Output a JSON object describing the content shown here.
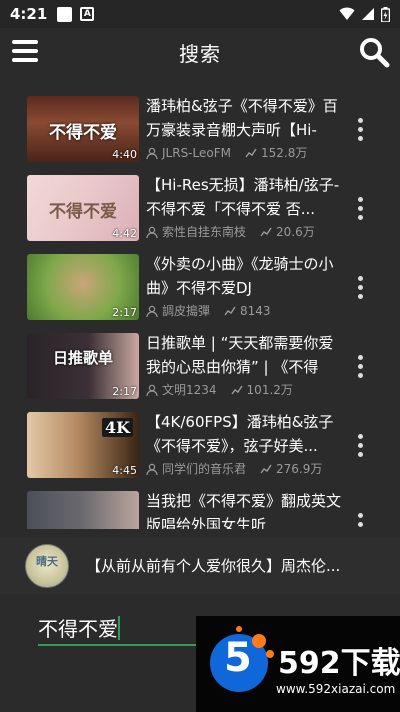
{
  "status_bar": {
    "time": "4:21",
    "notification_icon": "A"
  },
  "header": {
    "title": "搜索"
  },
  "results": [
    {
      "title": "潘玮柏&弦子《不得不爱》百万豪装录音棚大声听【Hi-",
      "thumb_text": "不得不爱",
      "duration": "4:40",
      "uploader": "JLRS-LeoFM",
      "views": "152.8万"
    },
    {
      "title": "【Hi-Res无损】潘玮柏/弦子-不得不爱「不得不爱 否...",
      "thumb_text": "不得不爱",
      "duration": "4:42",
      "uploader": "索性自挂东南枝",
      "views": "20.6万"
    },
    {
      "title": "《外卖の小曲》《龙骑士の小曲》不得不爱DJ",
      "thumb_text": "",
      "duration": "2:17",
      "uploader": "調皮搗彈",
      "views": "8143"
    },
    {
      "title": "日推歌单 | “天天都需要你爱 我的心思由你猜” | 《不得不...",
      "thumb_text": "日推歌单",
      "duration": "2:17",
      "uploader": "文明1234",
      "views": "101.2万"
    },
    {
      "title": "【4K/60FPS】潘玮柏&弦子《不得不爱》，弦子好美...",
      "thumb_text": "4K",
      "duration": "4:45",
      "uploader": "同学们的音乐君",
      "views": "276.9万"
    },
    {
      "title": "当我把《不得不爱》翻成英文版唱给外国女生听",
      "thumb_text": "",
      "duration": "",
      "uploader": "",
      "views": ""
    }
  ],
  "player": {
    "title": "【从前从前有个人爱你很久】周杰伦...",
    "avatar_text": "晴天"
  },
  "search": {
    "value": "不得不爱"
  },
  "watermark": {
    "brand": "592下载",
    "url": "www.592xiazai.com",
    "logo_digit": "5"
  },
  "colors": {
    "background": "#2b2b2b",
    "accent": "#2e9d5a",
    "meta_text": "#9a9a9a"
  }
}
